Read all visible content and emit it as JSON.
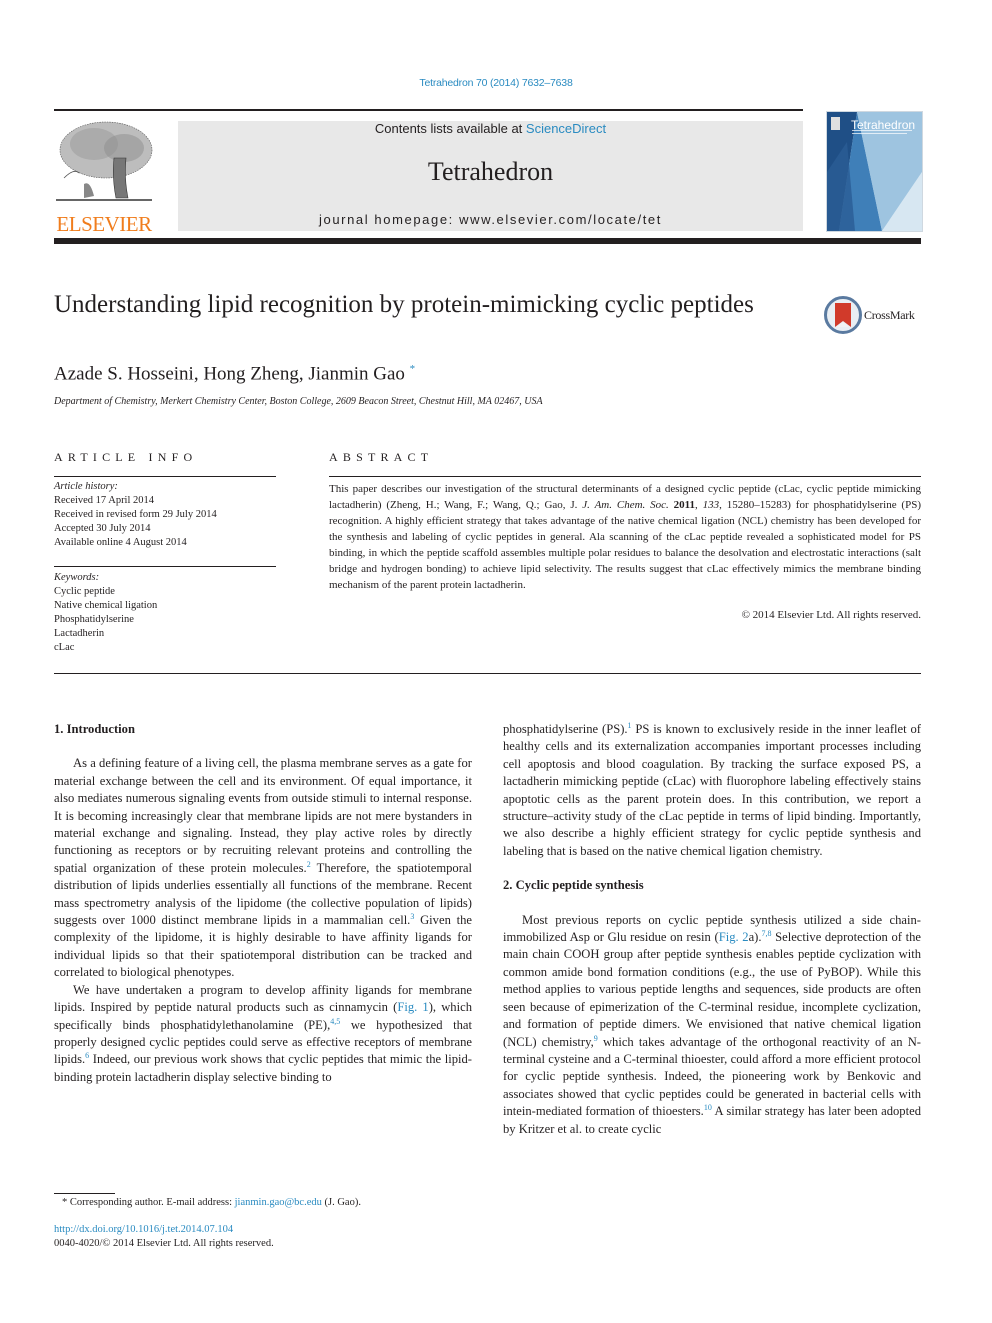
{
  "header": {
    "journal_reference": "Tetrahedron 70 (2014) 7632–7638",
    "contents_prefix": "Contents lists available at ",
    "contents_link": "ScienceDirect",
    "journal_title": "Tetrahedron",
    "homepage": "journal homepage: www.elsevier.com/locate/tet",
    "publisher_logo_text": "ELSEVIER",
    "cover_title": "Tetrahedron",
    "crossmark_label": "CrossMark"
  },
  "colors": {
    "link": "#2a8bc1",
    "elsevier_orange": "#f07d1d",
    "banner_gray": "#e8e8e8",
    "text": "#231f20"
  },
  "article": {
    "title": "Understanding lipid recognition by protein-mimicking cyclic peptides",
    "authors": "Azade S. Hosseini, Hong Zheng, Jianmin Gao",
    "corresponding_mark": "*",
    "affiliation": "Department of Chemistry, Merkert Chemistry Center, Boston College, 2609 Beacon Street, Chestnut Hill, MA 02467, USA"
  },
  "article_info": {
    "heading": "ARTICLE INFO",
    "history_label": "Article history:",
    "history": [
      "Received 17 April 2014",
      "Received in revised form 29 July 2014",
      "Accepted 30 July 2014",
      "Available online 4 August 2014"
    ],
    "keywords_label": "Keywords:",
    "keywords": [
      "Cyclic peptide",
      "Native chemical ligation",
      "Phosphatidylserine",
      "Lactadherin",
      "cLac"
    ]
  },
  "abstract": {
    "heading": "ABSTRACT",
    "part1": "This paper describes our investigation of the structural determinants of a designed cyclic peptide (cLac, cyclic peptide mimicking lactadherin) (Zheng, H.; Wang, F.; Wang, Q.; Gao, J. ",
    "journal_italic": "J. Am. Chem. Soc.",
    "year_bold": "2011",
    "volume_italic": "133",
    "part2": ", 15280–15283) for phosphatidylserine (PS) recognition. A highly efficient strategy that takes advantage of the native chemical ligation (NCL) chemistry has been developed for the synthesis and labeling of cyclic peptides in general. Ala scanning of the cLac peptide revealed a sophisticated model for PS binding, in which the peptide scaffold assembles multiple polar residues to balance the desolvation and electrostatic interactions (salt bridge and hydrogen bonding) to achieve lipid selectivity. The results suggest that cLac effectively mimics the membrane binding mechanism of the parent protein lactadherin.",
    "copyright": "© 2014 Elsevier Ltd. All rights reserved."
  },
  "body": {
    "sec1_heading": "1.  Introduction",
    "p1_a": "As a defining feature of a living cell, the plasma membrane serves as a gate for material exchange between the cell and its environment. Of equal importance, it also mediates numerous signaling events from outside stimuli to internal response. It is becoming increasingly clear that membrane lipids are not mere bystanders in material exchange and signaling. Instead, they play active roles by directly functioning as receptors or by recruiting relevant proteins and controlling the spatial organization of these protein molecules.",
    "ref2": "2",
    "p1_b": " Therefore, the spatiotemporal distribution of lipids underlies essentially all functions of the membrane. Recent mass spectrometry analysis of the lipidome (the collective population of lipids) suggests over 1000 distinct membrane lipids in a mammalian cell.",
    "ref3": "3",
    "p1_c": " Given the complexity of the lipidome, it is highly desirable to have affinity ligands for individual lipids so that their spatiotemporal distribution can be tracked and correlated to biological phenotypes.",
    "p2_a": "We have undertaken a program to develop affinity ligands for membrane lipids. Inspired by peptide natural products such as cinnamycin (",
    "fig1_link": "Fig. 1",
    "p2_b": "), which specifically binds phosphatidylethanolamine (PE),",
    "ref45": "4,5",
    "p2_c": " we hypothesized that properly designed cyclic peptides could serve as effective receptors of membrane lipids.",
    "ref6": "6",
    "p2_d": " Indeed, our previous work shows that cyclic peptides that mimic the lipid-binding protein lactadherin display selective binding to",
    "r_p1_a": "phosphatidylserine (PS).",
    "ref1": "1",
    "r_p1_b": " PS is known to exclusively reside in the inner leaflet of healthy cells and its externalization accompanies important processes including cell apoptosis and blood coagulation. By tracking the surface exposed PS, a lactadherin mimicking peptide (cLac) with fluorophore labeling effectively stains apoptotic cells as the parent protein does. In this contribution, we report a structure–activity study of the cLac peptide in terms of lipid binding. Importantly, we also describe a highly efficient strategy for cyclic peptide synthesis and labeling that is based on the native chemical ligation chemistry.",
    "sec2_heading": "2.  Cyclic peptide synthesis",
    "p3_a": "Most previous reports on cyclic peptide synthesis utilized a side chain-immobilized Asp or Glu residue on resin (",
    "fig2_link": "Fig. 2",
    "p3_b": "a).",
    "ref78": "7,8",
    "p3_c": " Selective deprotection of the main chain COOH group after peptide synthesis enables peptide cyclization with common amide bond formation conditions (e.g., the use of PyBOP). While this method applies to various peptide lengths and sequences, side products are often seen because of epimerization of the C-terminal residue, incomplete cyclization, and formation of peptide dimers. We envisioned that native chemical ligation (NCL) chemistry,",
    "ref9": "9",
    "p3_d": " which takes advantage of the orthogonal reactivity of an N-terminal cysteine and a C-terminal thioester, could afford a more efficient protocol for cyclic peptide synthesis. Indeed, the pioneering work by Benkovic and associates showed that cyclic peptides could be generated in bacterial cells with intein-mediated formation of thioesters.",
    "ref10": "10",
    "p3_e": " A similar strategy has later been adopted by Kritzer et al. to create cyclic"
  },
  "footer": {
    "footnote_mark": "*",
    "footnote_prefix": " Corresponding author. E-mail address: ",
    "email": "jianmin.gao@bc.edu",
    "footnote_suffix": " (J. Gao).",
    "doi": "http://dx.doi.org/10.1016/j.tet.2014.07.104",
    "issn": "0040-4020/© 2014 Elsevier Ltd. All rights reserved."
  }
}
